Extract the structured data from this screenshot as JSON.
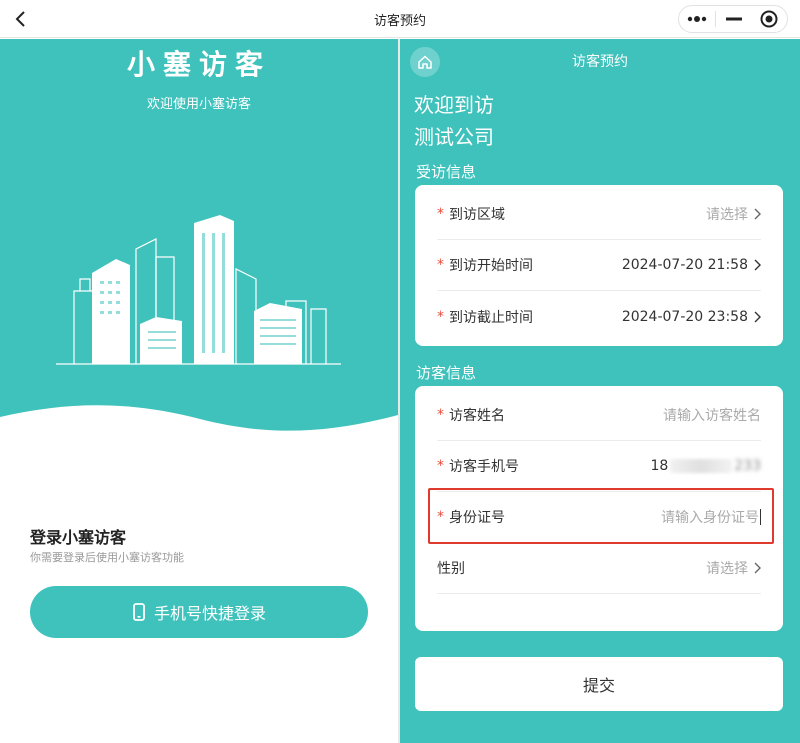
{
  "topbar": {
    "title": "访客预约"
  },
  "left": {
    "brand_title": "小塞访客",
    "brand_sub": "欢迎使用小塞访客",
    "login_title": "登录小塞访客",
    "login_sub": "你需要登录后使用小塞访客功能",
    "login_button": "手机号快捷登录"
  },
  "right": {
    "nav_title": "访客预约",
    "welcome_line1": "欢迎到访",
    "welcome_line2": "测试公司",
    "visit_section": "受访信息",
    "visitor_section": "访客信息",
    "visit_rows": [
      {
        "label": "到访区域",
        "value": "请选择",
        "required": "*"
      },
      {
        "label": "到访开始时间",
        "value": "2024-07-20 21:58",
        "required": "*"
      },
      {
        "label": "到访截止时间",
        "value": "2024-07-20 23:58",
        "required": "*"
      }
    ],
    "visitor_rows": [
      {
        "label": "访客姓名",
        "placeholder": "请输入访客姓名",
        "required": "*"
      },
      {
        "label": "访客手机号",
        "value_prefix": "18",
        "value_suffix": "233",
        "required": "*"
      },
      {
        "label": "身份证号",
        "placeholder": "请输入身份证号",
        "required": "*"
      },
      {
        "label": "性别",
        "value": "请选择"
      }
    ],
    "submit": "提交"
  },
  "colors": {
    "accent": "#3fc2bc",
    "required": "#e74c3c",
    "highlight": "#e03a2f"
  },
  "icons": [
    "back-icon",
    "more-dots-icon",
    "minimize-icon",
    "close-target-icon",
    "home-icon",
    "phone-icon",
    "chevron-right-icon"
  ]
}
